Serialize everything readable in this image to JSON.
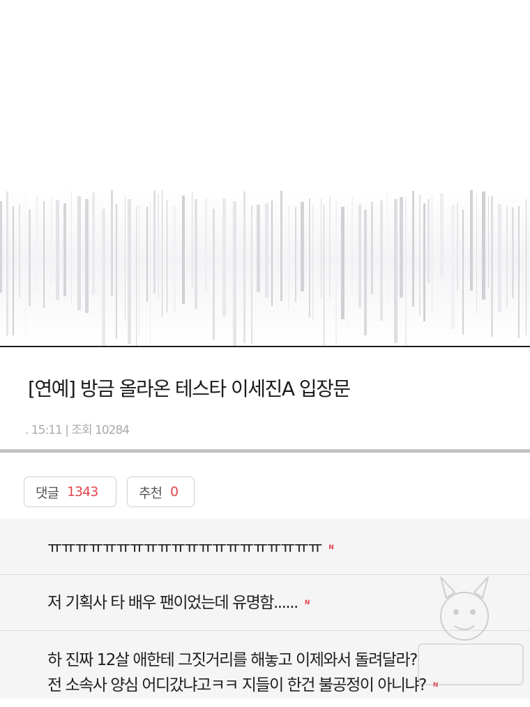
{
  "post": {
    "title": "[연예] 방금 올라온 테스타 이세진A 입장문",
    "time": ". 15:11",
    "separator": "|",
    "views_label": "조회",
    "views": "10284"
  },
  "actions": {
    "comments_label": "댓글",
    "comments_count": "1343",
    "recommend_label": "추천",
    "recommend_count": "0"
  },
  "comments": [
    {
      "lines": [
        "ㅠㅠㅠㅠㅠㅠㅠㅠㅠㅠㅠㅠㅠㅠㅠㅠㅠㅠㅠㅠ"
      ],
      "badge": "N"
    },
    {
      "lines": [
        "저 기획사 타 배우 팬이었는데 유명함......"
      ],
      "badge": "N"
    },
    {
      "lines": [
        "하 진짜 12살 애한테 그짓거리를 해놓고 이제와서 돌려달라?",
        "전 소속사 양심 어디갔냐고ㅋㅋ 지들이 한건 불공정이 아니냐?"
      ],
      "badge": "N"
    }
  ],
  "colors": {
    "accent": "#e2454e",
    "meta_gray": "#a9a9a9",
    "comment_bg": "#f5f5f5",
    "divider_dark": "#1e1e1e",
    "divider_mid": "#c2c2c2"
  }
}
